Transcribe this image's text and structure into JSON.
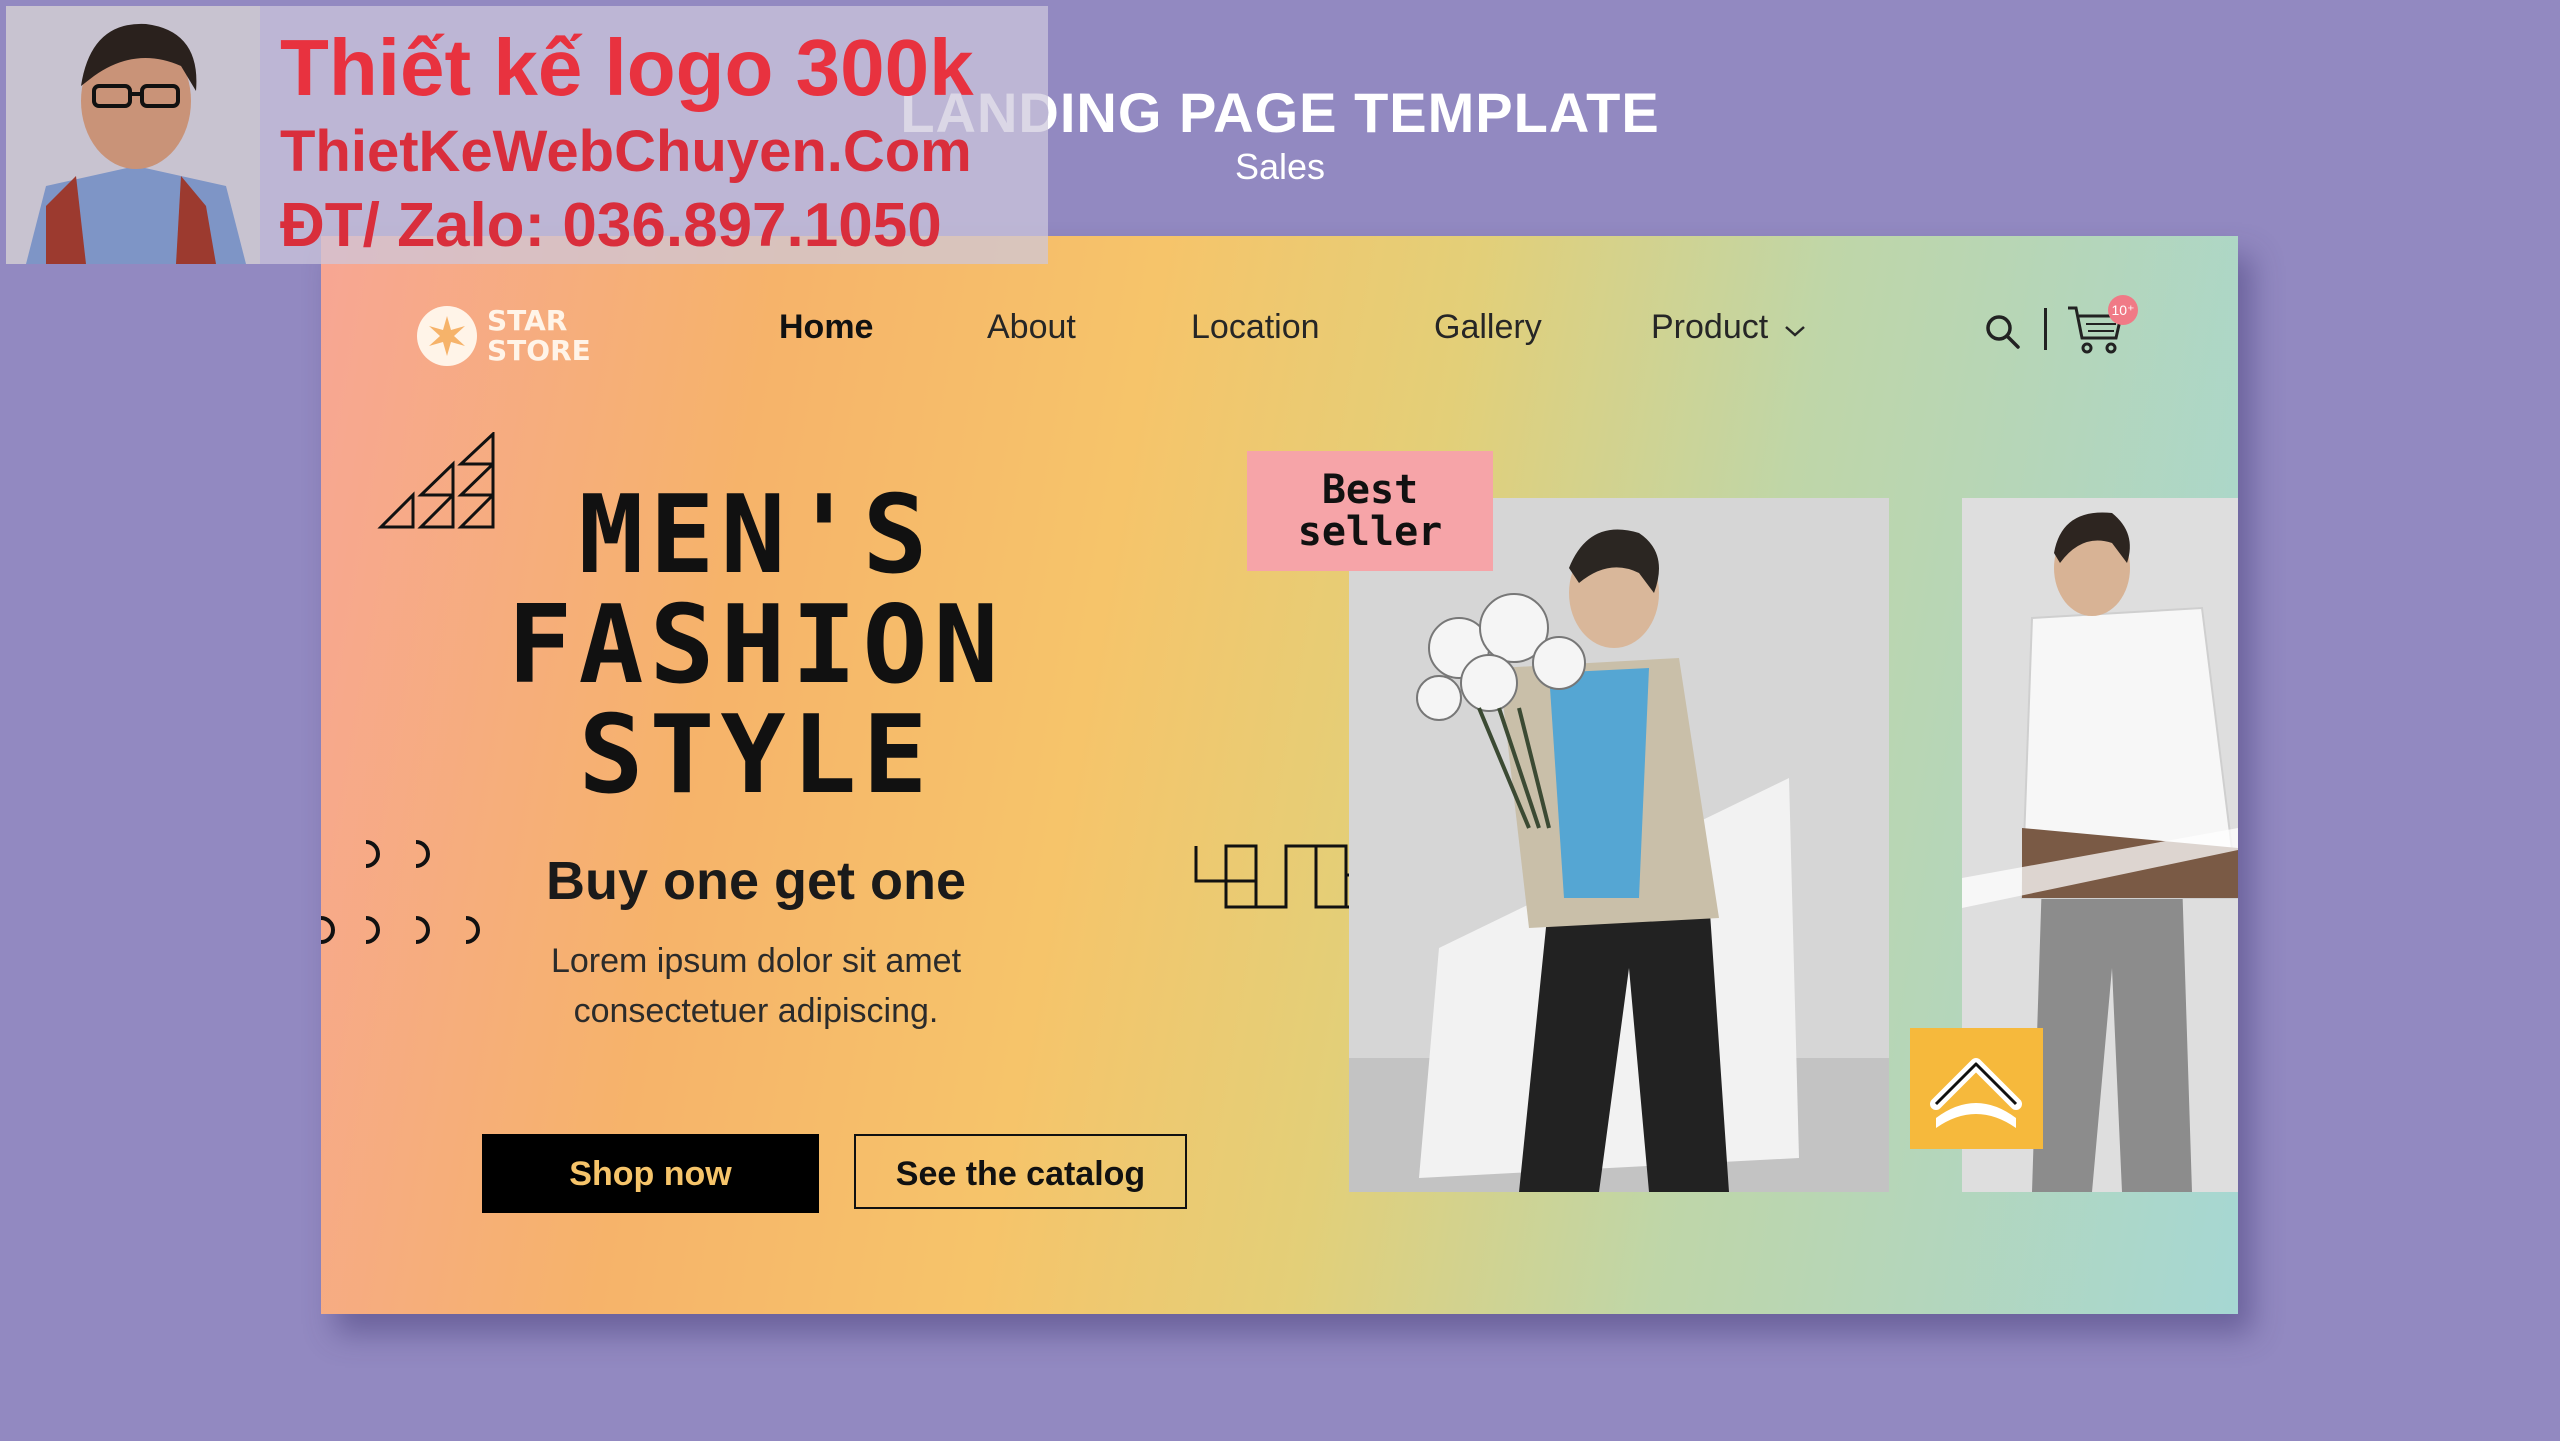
{
  "page": {
    "title": "LANDING PAGE TEMPLATE",
    "subtitle": "Sales"
  },
  "watermark": {
    "line1": "Thiết kế logo 300k",
    "line2": "ThietKeWebChuyen.Com",
    "line3": "ĐT/ Zalo: 036.897.1050"
  },
  "site": {
    "logo": {
      "line1": "STAR",
      "line2": "STORE",
      "icon": "star-burst-icon"
    },
    "nav": [
      {
        "label": "Home",
        "active": true
      },
      {
        "label": "About"
      },
      {
        "label": "Location"
      },
      {
        "label": "Gallery"
      },
      {
        "label": "Product",
        "has_dropdown": true,
        "dropdown_icon": "chevron-down-icon"
      }
    ],
    "cart_badge": "10⁺",
    "icons": {
      "search": "search-icon",
      "cart": "cart-icon",
      "scroll_up": "chevron-up-icon"
    }
  },
  "hero": {
    "title_line1": "MEN'S",
    "title_line2": "FASHION",
    "title_line3": "STYLE",
    "subtitle": "Buy one get one",
    "body_line1": "Lorem ipsum dolor sit amet",
    "body_line2": "consectetuer adipiscing.",
    "primary_button": "Shop now",
    "secondary_button": "See the catalog",
    "badge": "Best\nseller"
  },
  "colors": {
    "background": "#9289c1",
    "accent_yellow": "#f6b93c",
    "badge_pink": "#f6a4a8",
    "watermark_red": "#e8323f"
  }
}
